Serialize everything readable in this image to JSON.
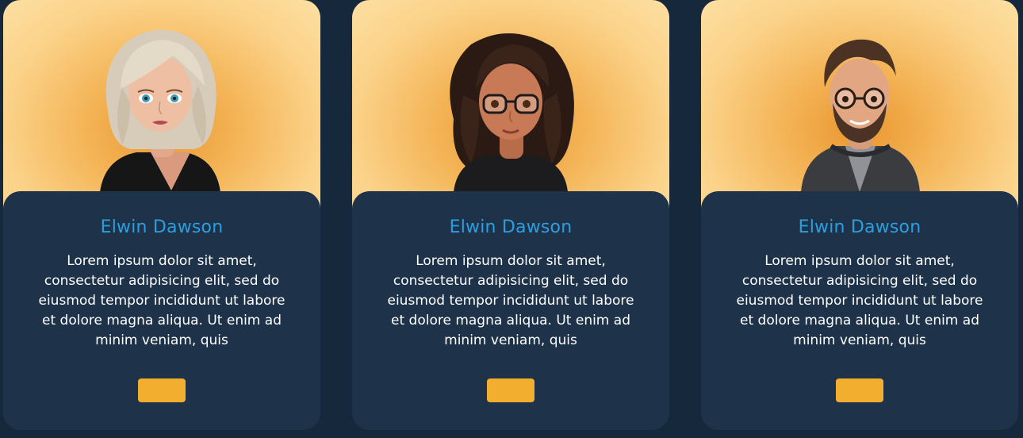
{
  "cards": [
    {
      "name": "Elwin Dawson",
      "description": "Lorem ipsum dolor sit amet, consectetur adipisicing elit, sed do eiusmod tempor incididunt ut labore et dolore magna aliqua. Ut enim ad minim veniam, quis",
      "button_label": "",
      "avatar": "avatar-woman-blonde"
    },
    {
      "name": "Elwin Dawson",
      "description": "Lorem ipsum dolor sit amet, consectetur adipisicing elit, sed do eiusmod tempor incididunt ut labore et dolore magna aliqua. Ut enim ad minim veniam, quis",
      "button_label": "",
      "avatar": "avatar-woman-glasses"
    },
    {
      "name": "Elwin Dawson",
      "description": "Lorem ipsum dolor sit amet, consectetur adipisicing elit, sed do eiusmod tempor incididunt ut labore et dolore magna aliqua. Ut enim ad minim veniam, quis",
      "button_label": "",
      "avatar": "avatar-man-glasses"
    }
  ],
  "colors": {
    "page_background": "#16283b",
    "card_background": "#1e3249",
    "name_color": "#2a9fe0",
    "button_color": "#f1ae2f",
    "photo_glow": "#e9962f"
  }
}
